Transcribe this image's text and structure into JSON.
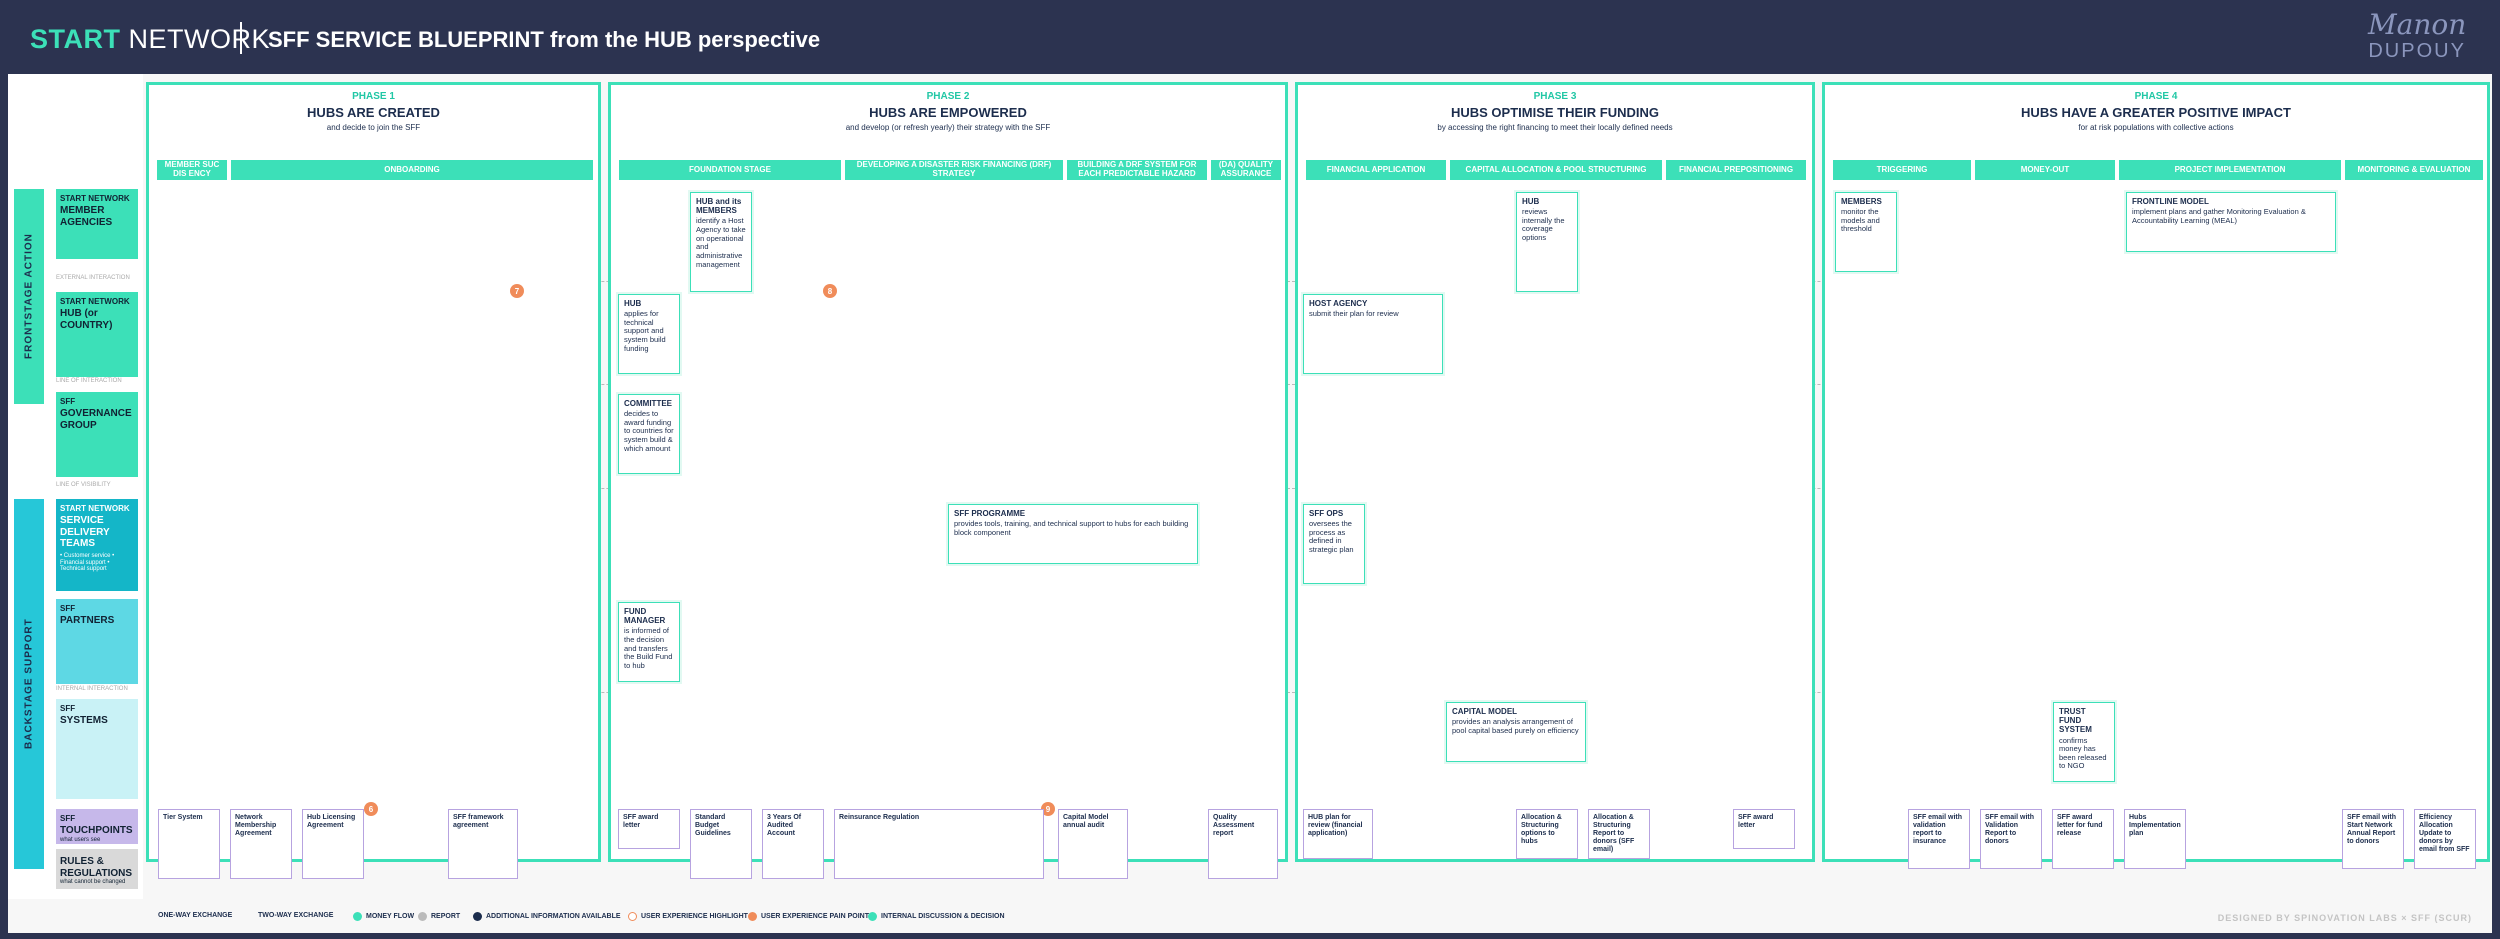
{
  "header": {
    "brand_a": "START",
    "brand_b": " NETWORK",
    "title": "SFF SERVICE BLUEPRINT from the HUB perspective",
    "sig1": "Manon",
    "sig2": "DUPOUY"
  },
  "side": {
    "front": "FRONTSTAGE ACTION",
    "back": "BACKSTAGE SUPPORT"
  },
  "lanes": [
    {
      "tag": "START NETWORK",
      "name": "MEMBER AGENCIES"
    },
    {
      "tag": "START NETWORK",
      "name": "HUB (or COUNTRY)"
    },
    {
      "tag": "SFF",
      "name": "GOVERNANCE GROUP"
    },
    {
      "tag": "START NETWORK",
      "name": "SERVICE DELIVERY TEAMS",
      "sub": "• Customer service • Financial support • Technical support"
    },
    {
      "tag": "SFF",
      "name": "PARTNERS"
    },
    {
      "tag": "SFF",
      "name": "SYSTEMS"
    },
    {
      "tag": "SFF",
      "name": "TOUCHPOINTS",
      "sub": "what users see"
    },
    {
      "tag": "",
      "name": "RULES & REGULATIONS",
      "sub": "what cannot be changed"
    }
  ],
  "dividers": [
    "EXTERNAL INTERACTION",
    "LINE OF INTERACTION",
    "LINE OF VISIBILITY",
    "INTERNAL INTERACTION"
  ],
  "phases": [
    {
      "label": "PHASE 1",
      "name": "HUBS ARE CREATED",
      "sub": "and decide to join the SFF",
      "stages": [
        "MEMBER SUC DIS ENCY",
        "ONBOARDING"
      ]
    },
    {
      "label": "PHASE 2",
      "name": "HUBS ARE EMPOWERED",
      "sub": "and develop (or refresh yearly) their strategy with the SFF",
      "stages": [
        "FOUNDATION STAGE",
        "DEVELOPING A DISASTER RISK FINANCING (DRF) STRATEGY",
        "BUILDING A DRF SYSTEM FOR EACH PREDICTABLE HAZARD",
        "(DA) QUALITY ASSURANCE"
      ]
    },
    {
      "label": "PHASE 3",
      "name": "HUBS OPTIMISE THEIR FUNDING",
      "sub": "by accessing the right financing to meet their locally defined needs",
      "stages": [
        "FINANCIAL APPLICATION",
        "CAPITAL ALLOCATION & POOL STRUCTURING",
        "FINANCIAL PREPOSITIONING"
      ]
    },
    {
      "label": "PHASE 4",
      "name": "HUBS HAVE A GREATER POSITIVE IMPACT",
      "sub": "for at risk populations with collective actions",
      "stages": [
        "TRIGGERING",
        "MONEY-OUT",
        "PROJECT IMPLEMENTATION",
        "MONITORING & EVALUATION"
      ]
    }
  ],
  "cards": [
    {
      "actor": "HUB and its MEMBERS",
      "text": "identify a Host Agency to take on operational and administrative management"
    },
    {
      "actor": "HUB",
      "text": "applies for technical support and system build funding"
    },
    {
      "actor": "HOST AGENCY",
      "text": "submit their plan for review"
    },
    {
      "actor": "HUB",
      "text": "reviews internally the coverage options"
    },
    {
      "actor": "MEMBERS",
      "text": "monitor the models and threshold"
    },
    {
      "actor": "FRONTLINE MODEL",
      "text": "implement plans and gather Monitoring Evaluation & Accountability Learning (MEAL)"
    },
    {
      "actor": "COMMITTEE",
      "text": "decides to award funding to countries for system build & which amount"
    },
    {
      "actor": "SFF PROGRAMME",
      "text": "provides tools, training, and technical support to hubs for each building block component"
    },
    {
      "actor": "SFF OPS",
      "text": "oversees the process as defined in strategic plan"
    },
    {
      "actor": "FUND MANAGER",
      "text": "is informed of the decision and transfers the Build Fund to hub"
    },
    {
      "actor": "CAPITAL MODEL",
      "text": "provides an analysis arrangement of pool capital based purely on efficiency"
    },
    {
      "actor": "TRUST FUND SYSTEM",
      "text": "confirms money has been released to NGO"
    }
  ],
  "touchpoints": [
    "Tier System",
    "Network Membership Agreement",
    "Hub Licensing Agreement",
    "SFF framework agreement",
    "SFF award letter",
    "Standard Budget Guidelines",
    "3 Years Of Audited Account",
    "Reinsurance Regulation",
    "Capital Model annual audit",
    "Quality Assessment report",
    "HUB plan for review (financial application)",
    "Allocation & Structuring options to hubs",
    "Allocation & Structuring Report to donors (SFF email)",
    "SFF award letter",
    "SFF email with validation report to insurance",
    "SFF email with Validation Report to donors",
    "SFF award letter for fund release",
    "Hubs Implementation plan",
    "SFF email with Start Network Annual Report to donors",
    "Efficiency Allocation Update to donors by email from SFF"
  ],
  "legend": [
    "ONE-WAY EXCHANGE",
    "TWO-WAY EXCHANGE",
    "MONEY FLOW",
    "REPORT",
    "ADDITIONAL INFORMATION AVAILABLE",
    "USER EXPERIENCE HIGHLIGHT",
    "USER EXPERIENCE PAIN POINT",
    "INTERNAL DISCUSSION & DECISION"
  ],
  "footer": "DESIGNED BY SPINOVATION LABS × SFF (SCUR)"
}
